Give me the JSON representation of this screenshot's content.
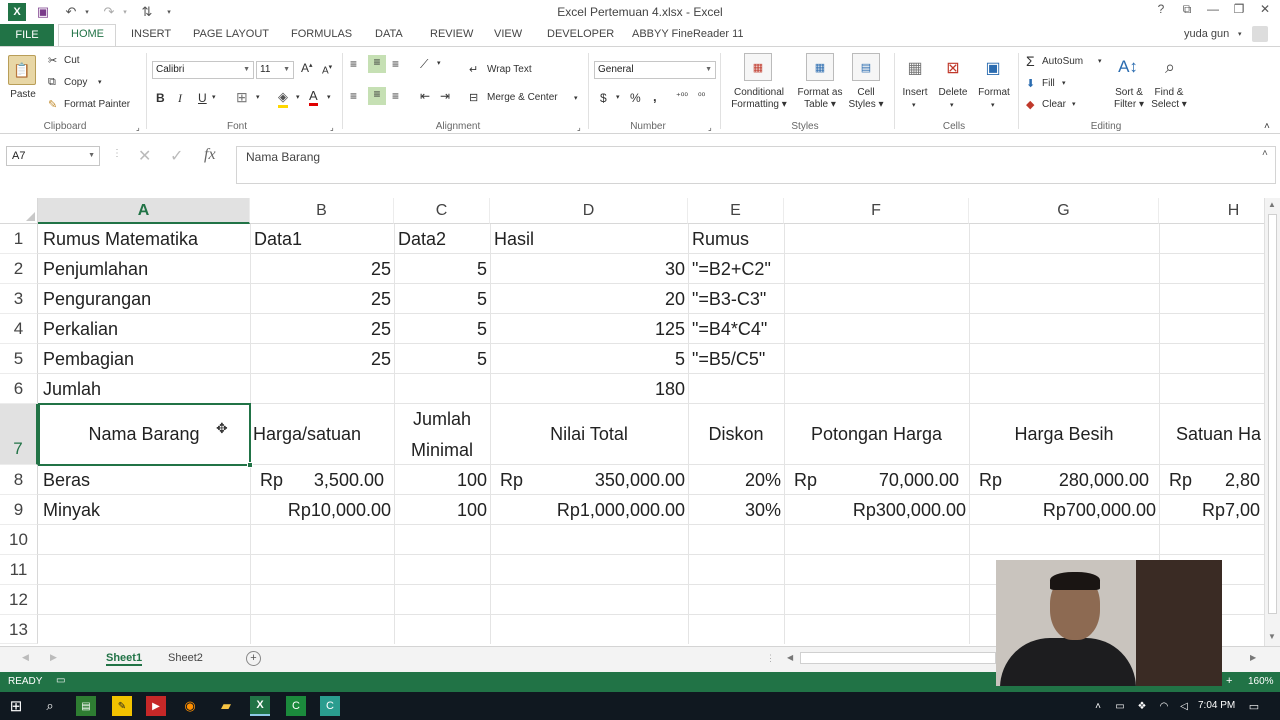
{
  "titlebar": {
    "title": "Excel Pertemuan 4.xlsx - Excel",
    "window_buttons": [
      "?",
      "⧉",
      "—",
      "❐",
      "✕"
    ]
  },
  "ribbon_tabs": [
    "FILE",
    "HOME",
    "INSERT",
    "PAGE LAYOUT",
    "FORMULAS",
    "DATA",
    "REVIEW",
    "VIEW",
    "DEVELOPER",
    "ABBYY FineReader 11"
  ],
  "user": "yuda gun",
  "clipboard": {
    "paste": "Paste",
    "cut": "Cut",
    "copy": "Copy",
    "format_painter": "Format Painter",
    "label": "Clipboard"
  },
  "font": {
    "name": "Calibri",
    "size": "11",
    "label": "Font",
    "bold": "B",
    "italic": "I",
    "underline": "U"
  },
  "alignment": {
    "wrap_text": "Wrap Text",
    "merge_center": "Merge & Center",
    "label": "Alignment"
  },
  "number": {
    "format": "General",
    "currency": "$",
    "percent": "%",
    "comma": ",",
    "label": "Number"
  },
  "styles": {
    "conditional_1": "Conditional",
    "conditional_2": "Formatting",
    "format_as_1": "Format as",
    "format_as_2": "Table",
    "cell_1": "Cell",
    "cell_2": "Styles",
    "label": "Styles"
  },
  "cells": {
    "insert": "Insert",
    "delete": "Delete",
    "format": "Format",
    "label": "Cells"
  },
  "editing": {
    "autosum": "AutoSum",
    "fill": "Fill",
    "clear": "Clear",
    "sort_1": "Sort &",
    "sort_2": "Filter",
    "find_1": "Find &",
    "find_2": "Select",
    "label": "Editing"
  },
  "formula_bar": {
    "name_box": "A7",
    "content": "Nama Barang",
    "fx": "fx"
  },
  "columns": [
    "A",
    "B",
    "C",
    "D",
    "E",
    "F",
    "G",
    "H"
  ],
  "rows": [
    "1",
    "2",
    "3",
    "4",
    "5",
    "6",
    "7",
    "8",
    "9",
    "10",
    "11",
    "12",
    "13"
  ],
  "cells_data": {
    "r1": {
      "a": "Rumus Matematika",
      "b": "Data1",
      "c": "Data2",
      "d": "Hasil",
      "e": "Rumus"
    },
    "r2": {
      "a": "Penjumlahan",
      "b": "25",
      "c": "5",
      "d": "30",
      "e": "\"=B2+C2\""
    },
    "r3": {
      "a": "Pengurangan",
      "b": "25",
      "c": "5",
      "d": "20",
      "e": "\"=B3-C3\""
    },
    "r4": {
      "a": "Perkalian",
      "b": "25",
      "c": "5",
      "d": "125",
      "e": "\"=B4*C4\""
    },
    "r5": {
      "a": "Pembagian",
      "b": "25",
      "c": "5",
      "d": "5",
      "e": "\"=B5/C5\""
    },
    "r6": {
      "a": "Jumlah",
      "d": "180"
    },
    "r7": {
      "a": "Nama Barang",
      "b": "Harga/satuan",
      "c1": "Jumlah",
      "c2": "Minimal",
      "d": "Nilai Total",
      "e": "Diskon",
      "f": "Potongan Harga",
      "g": "Harga Besih",
      "h": "Satuan Ha"
    },
    "r8": {
      "a": "Beras",
      "b_cur": "Rp",
      "b": "3,500.00",
      "c": "100",
      "d_cur": "Rp",
      "d": "350,000.00",
      "e": "20%",
      "f_cur": "Rp",
      "f": "70,000.00",
      "g_cur": "Rp",
      "g": "280,000.00",
      "h_cur": "Rp",
      "h": "2,80"
    },
    "r9": {
      "a": "Minyak",
      "b": "Rp10,000.00",
      "c": "100",
      "d": "Rp1,000,000.00",
      "e": "30%",
      "f": "Rp300,000.00",
      "g": "Rp700,000.00",
      "h": "Rp7,00"
    }
  },
  "sheets": [
    "Sheet1",
    "Sheet2"
  ],
  "status": {
    "ready": "READY",
    "zoom": "160%"
  },
  "taskbar": {
    "time": "7:04 PM"
  }
}
